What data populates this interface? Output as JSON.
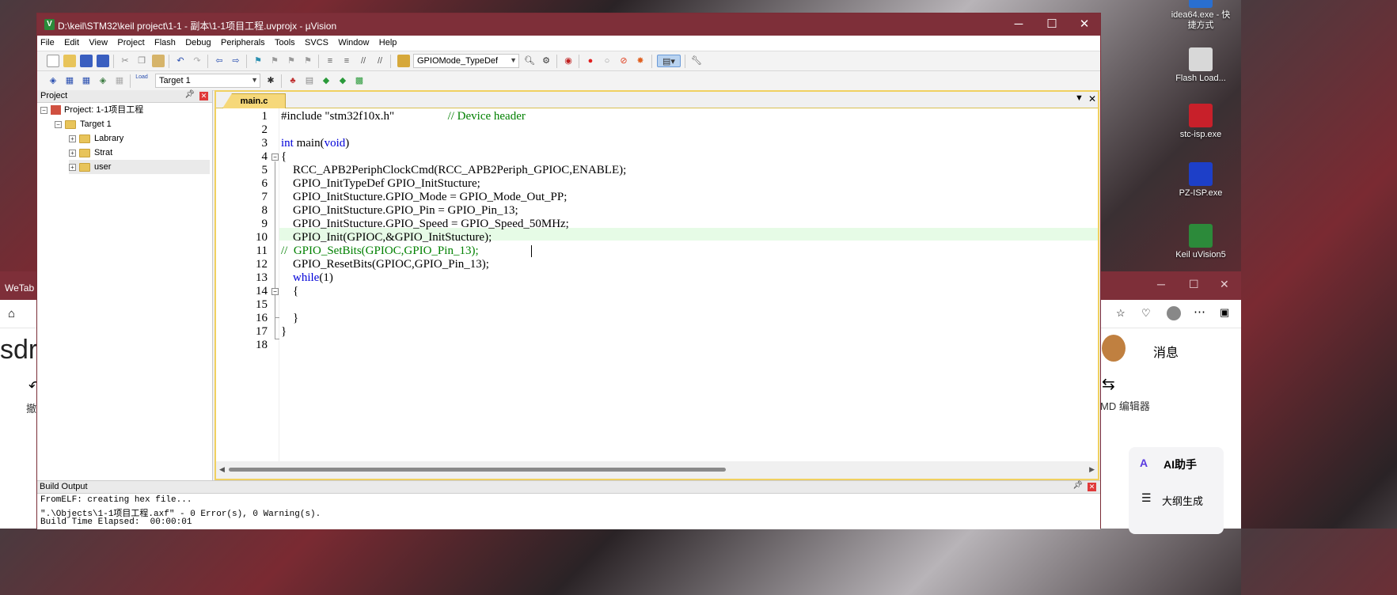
{
  "desktop_icons": [
    {
      "label": "idea64.exe - 快捷方式"
    },
    {
      "label": "Flash Load..."
    },
    {
      "label": "stc-isp.exe"
    },
    {
      "label": "PZ-ISP.exe"
    },
    {
      "label": "Keil uVision5"
    }
  ],
  "background_browser": {
    "title": "WeTab 新",
    "left_text": "sdr",
    "left_action": "撤",
    "right_messages": "消息",
    "right_md_editor": "MD 编辑器",
    "ai_assistant": "AI助手",
    "outline": "大纲生成"
  },
  "window": {
    "title": "D:\\keil\\STM32\\keil project\\1-1 - 副本\\1-1项目工程.uvprojx - µVision",
    "minimize": "─",
    "maximize": "☐",
    "close": "✕"
  },
  "menu": [
    "File",
    "Edit",
    "View",
    "Project",
    "Flash",
    "Debug",
    "Peripherals",
    "Tools",
    "SVCS",
    "Window",
    "Help"
  ],
  "toolbar1": {
    "find_combo": "GPIOMode_TypeDef"
  },
  "toolbar2": {
    "target_combo": "Target 1",
    "load_label": "Load"
  },
  "project_pane": {
    "title": "Project",
    "tree": [
      {
        "label": "Project: 1-1项目工程"
      },
      {
        "label": "Target 1"
      },
      {
        "label": "Labrary"
      },
      {
        "label": "Strat"
      },
      {
        "label": "user"
      }
    ]
  },
  "editor": {
    "tab": "main.c",
    "lines": [
      {
        "n": "1",
        "t": "#include \"stm32f10x.h\"                  // Device header"
      },
      {
        "n": "2",
        "t": ""
      },
      {
        "n": "3",
        "t": "int main(void)"
      },
      {
        "n": "4",
        "t": "{"
      },
      {
        "n": "5",
        "t": "    RCC_APB2PeriphClockCmd(RCC_APB2Periph_GPIOC,ENABLE);"
      },
      {
        "n": "6",
        "t": "    GPIO_InitTypeDef GPIO_InitStucture;"
      },
      {
        "n": "7",
        "t": "    GPIO_InitStucture.GPIO_Mode = GPIO_Mode_Out_PP;"
      },
      {
        "n": "8",
        "t": "    GPIO_InitStucture.GPIO_Pin = GPIO_Pin_13;"
      },
      {
        "n": "9",
        "t": "    GPIO_InitStucture.GPIO_Speed = GPIO_Speed_50MHz;"
      },
      {
        "n": "10",
        "t": "    GPIO_Init(GPIOC,&GPIO_InitStucture);"
      },
      {
        "n": "11",
        "t": "//  GPIO_SetBits(GPIOC,GPIO_Pin_13);"
      },
      {
        "n": "12",
        "t": "    GPIO_ResetBits(GPIOC,GPIO_Pin_13);"
      },
      {
        "n": "13",
        "t": "    while(1)"
      },
      {
        "n": "14",
        "t": "    {"
      },
      {
        "n": "15",
        "t": ""
      },
      {
        "n": "16",
        "t": "    }"
      },
      {
        "n": "17",
        "t": "}"
      },
      {
        "n": "18",
        "t": ""
      }
    ]
  },
  "build_output": {
    "title": "Build Output",
    "lines": [
      "FromELF: creating hex file...",
      "\".\\Objects\\1-1项目工程.axf\" - 0 Error(s), 0 Warning(s).",
      "Build Time Elapsed:  00:00:01"
    ]
  }
}
